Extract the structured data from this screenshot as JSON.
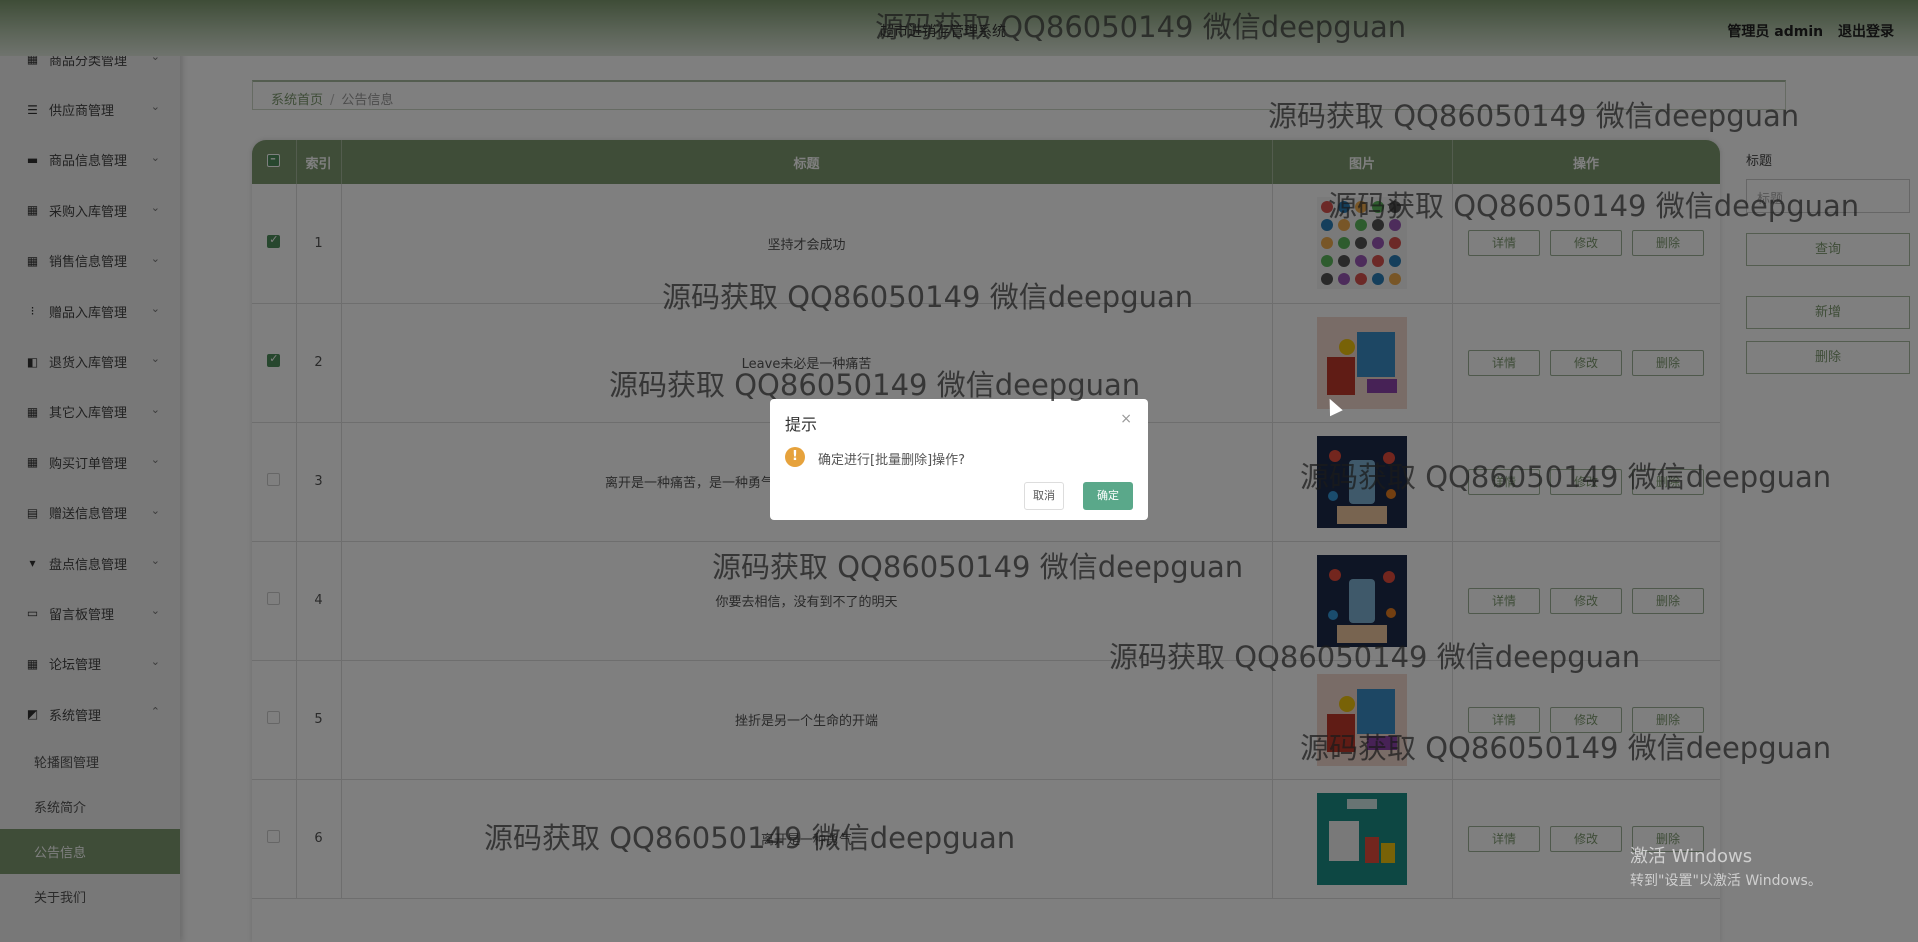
{
  "header": {
    "title": "超市进销存管理系统",
    "user_label": "管理员 admin",
    "logout_label": "退出登录"
  },
  "sidebar": {
    "items": [
      {
        "label": "商品分类管理",
        "icon": "grid-icon",
        "glyph": "▦"
      },
      {
        "label": "供应商管理",
        "icon": "list-icon",
        "glyph": "☰"
      },
      {
        "label": "商品信息管理",
        "icon": "chat-icon",
        "glyph": "▬"
      },
      {
        "label": "采购入库管理",
        "icon": "grid-icon",
        "glyph": "▦"
      },
      {
        "label": "销售信息管理",
        "icon": "grid-icon",
        "glyph": "▦"
      },
      {
        "label": "赠品入库管理",
        "icon": "apps-icon",
        "glyph": "⁝"
      },
      {
        "label": "退货入库管理",
        "icon": "thumb-icon",
        "glyph": "◧"
      },
      {
        "label": "其它入库管理",
        "icon": "grid-icon",
        "glyph": "▦"
      },
      {
        "label": "购买订单管理",
        "icon": "grid-icon",
        "glyph": "▦"
      },
      {
        "label": "赠送信息管理",
        "icon": "clipboard-icon",
        "glyph": "▤"
      },
      {
        "label": "盘点信息管理",
        "icon": "stamp-icon",
        "glyph": "▾"
      },
      {
        "label": "留言板管理",
        "icon": "printer-icon",
        "glyph": "▭"
      },
      {
        "label": "论坛管理",
        "icon": "grid-icon",
        "glyph": "▦"
      },
      {
        "label": "系统管理",
        "icon": "chart-icon",
        "glyph": "◩"
      }
    ],
    "chevron_down": "⌄",
    "chevron_up": "⌃",
    "submenu": [
      {
        "label": "轮播图管理"
      },
      {
        "label": "系统简介"
      },
      {
        "label": "公告信息"
      },
      {
        "label": "关于我们"
      }
    ]
  },
  "breadcrumb": {
    "home": "系统首页",
    "sep": "/",
    "current": "公告信息"
  },
  "table": {
    "columns": [
      "索引",
      "标题",
      "图片",
      "操作"
    ],
    "rows": [
      {
        "index": "1",
        "title": "坚持才会成功",
        "checked": true,
        "img": "icons"
      },
      {
        "index": "2",
        "title": "Leave未必是一种痛苦",
        "checked": true,
        "img": "shop"
      },
      {
        "index": "3",
        "title": "离开是一种痛苦，是一种勇气，但同样也是一个考验，是一个新的开端",
        "checked": false,
        "img": "phone"
      },
      {
        "index": "4",
        "title": "你要去相信，没有到不了的明天",
        "checked": false,
        "img": "phone"
      },
      {
        "index": "5",
        "title": "挫折是另一个生命的开端",
        "checked": false,
        "img": "shop"
      },
      {
        "index": "6",
        "title": "离开是一种勇气",
        "checked": false,
        "img": "online"
      }
    ],
    "actions": {
      "detail": "详情",
      "edit": "修改",
      "delete": "删除"
    }
  },
  "search": {
    "label": "标题",
    "placeholder": "标题",
    "query_label": "查询",
    "add_label": "新增",
    "delete_label": "删除"
  },
  "dialog": {
    "title": "提示",
    "close": "×",
    "warn_glyph": "!",
    "message": "确定进行[批量删除]操作?",
    "cancel": "取消",
    "confirm": "确定"
  },
  "watermark": "源码获取 QQ86050149 微信deepguan",
  "windows_notice": {
    "line1": "激活 Windows",
    "line2": "转到\"设置\"以激活 Windows。"
  },
  "colors": {
    "accent": "#7e9a70",
    "confirm": "#5aa88a",
    "warn": "#e6a23c"
  }
}
